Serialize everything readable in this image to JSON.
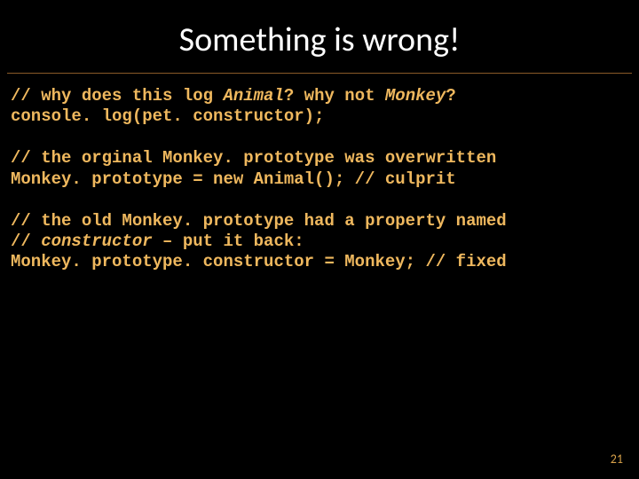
{
  "title": "Something is wrong!",
  "blocks": {
    "b1": {
      "l1a": "// why does this log ",
      "l1b": "Animal",
      "l1c": "? why not ",
      "l1d": "Monkey",
      "l1e": "?",
      "l2": "console. log(pet. constructor);"
    },
    "b2": {
      "l1": "// the orginal Monkey. prototype was overwritten",
      "l2": "Monkey. prototype = new Animal(); // culprit"
    },
    "b3": {
      "l1": "// the old Monkey. prototype had a property named",
      "l2a": "// ",
      "l2b": "constructor",
      "l2c": " – put it back:",
      "l3": "Monkey. prototype. constructor = Monkey; // fixed"
    }
  },
  "page_number": "21"
}
